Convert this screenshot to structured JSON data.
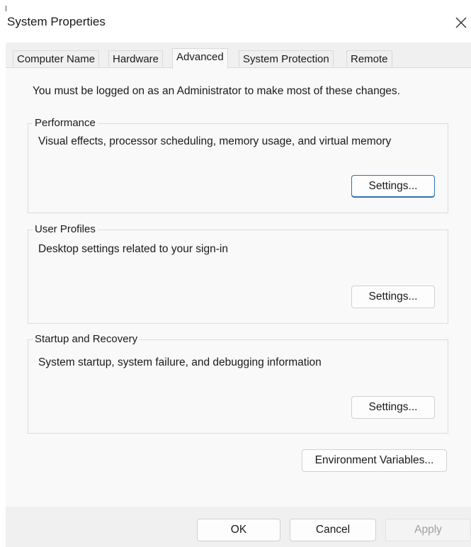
{
  "window": {
    "title": "System Properties",
    "close_icon": "close-icon"
  },
  "tabs": [
    {
      "label": "Computer Name",
      "active": false
    },
    {
      "label": "Hardware",
      "active": false
    },
    {
      "label": "Advanced",
      "active": true
    },
    {
      "label": "System Protection",
      "active": false
    },
    {
      "label": "Remote",
      "active": false
    }
  ],
  "advanced": {
    "admin_note": "You must be logged on as an Administrator to make most of these changes.",
    "performance": {
      "legend": "Performance",
      "description": "Visual effects, processor scheduling, memory usage, and virtual memory",
      "button": "Settings..."
    },
    "user_profiles": {
      "legend": "User Profiles",
      "description": "Desktop settings related to your sign-in",
      "button": "Settings..."
    },
    "startup_recovery": {
      "legend": "Startup and Recovery",
      "description": "System startup, system failure, and debugging information",
      "button": "Settings..."
    },
    "env_button": "Environment Variables..."
  },
  "footer": {
    "ok": "OK",
    "cancel": "Cancel",
    "apply": "Apply",
    "apply_enabled": false
  },
  "colors": {
    "focus_border": "#2f6fb5",
    "panel_bg": "#f9f9f9",
    "window_bg": "#f0f0f0"
  }
}
